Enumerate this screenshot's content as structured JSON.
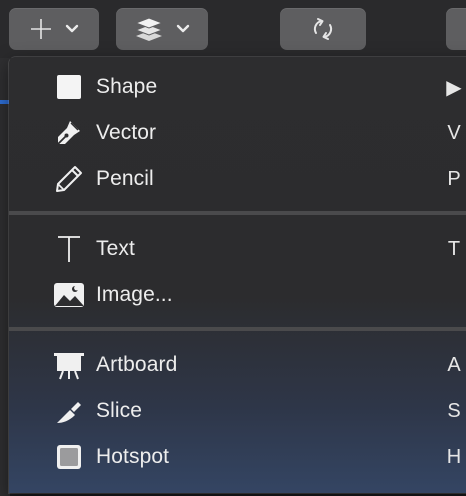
{
  "toolbar": {
    "insert_button": {
      "icon": "plus-icon",
      "menu_icon": "chevron-down-icon"
    },
    "layers_button": {
      "icon": "layers-icon",
      "menu_icon": "chevron-down-icon"
    },
    "refresh_button": {
      "icon": "refresh-icon"
    }
  },
  "menu": {
    "items": [
      {
        "label": "Shape",
        "shortcut": "▶",
        "icon": "square-icon"
      },
      {
        "label": "Vector",
        "shortcut": "V",
        "icon": "pen-tool-icon"
      },
      {
        "label": "Pencil",
        "shortcut": "P",
        "icon": "pencil-icon"
      },
      {
        "label": "Text",
        "shortcut": "T",
        "icon": "text-icon"
      },
      {
        "label": "Image...",
        "shortcut": "",
        "icon": "image-icon"
      },
      {
        "label": "Artboard",
        "shortcut": "A",
        "icon": "artboard-icon"
      },
      {
        "label": "Slice",
        "shortcut": "S",
        "icon": "knife-icon"
      },
      {
        "label": "Hotspot",
        "shortcut": "H",
        "icon": "hotspot-icon"
      }
    ]
  },
  "colors": {
    "menu_bg": "#2d2d2f",
    "button_bg": "#5e5e60",
    "text": "#ededed",
    "accent": "#2e6fd8"
  }
}
